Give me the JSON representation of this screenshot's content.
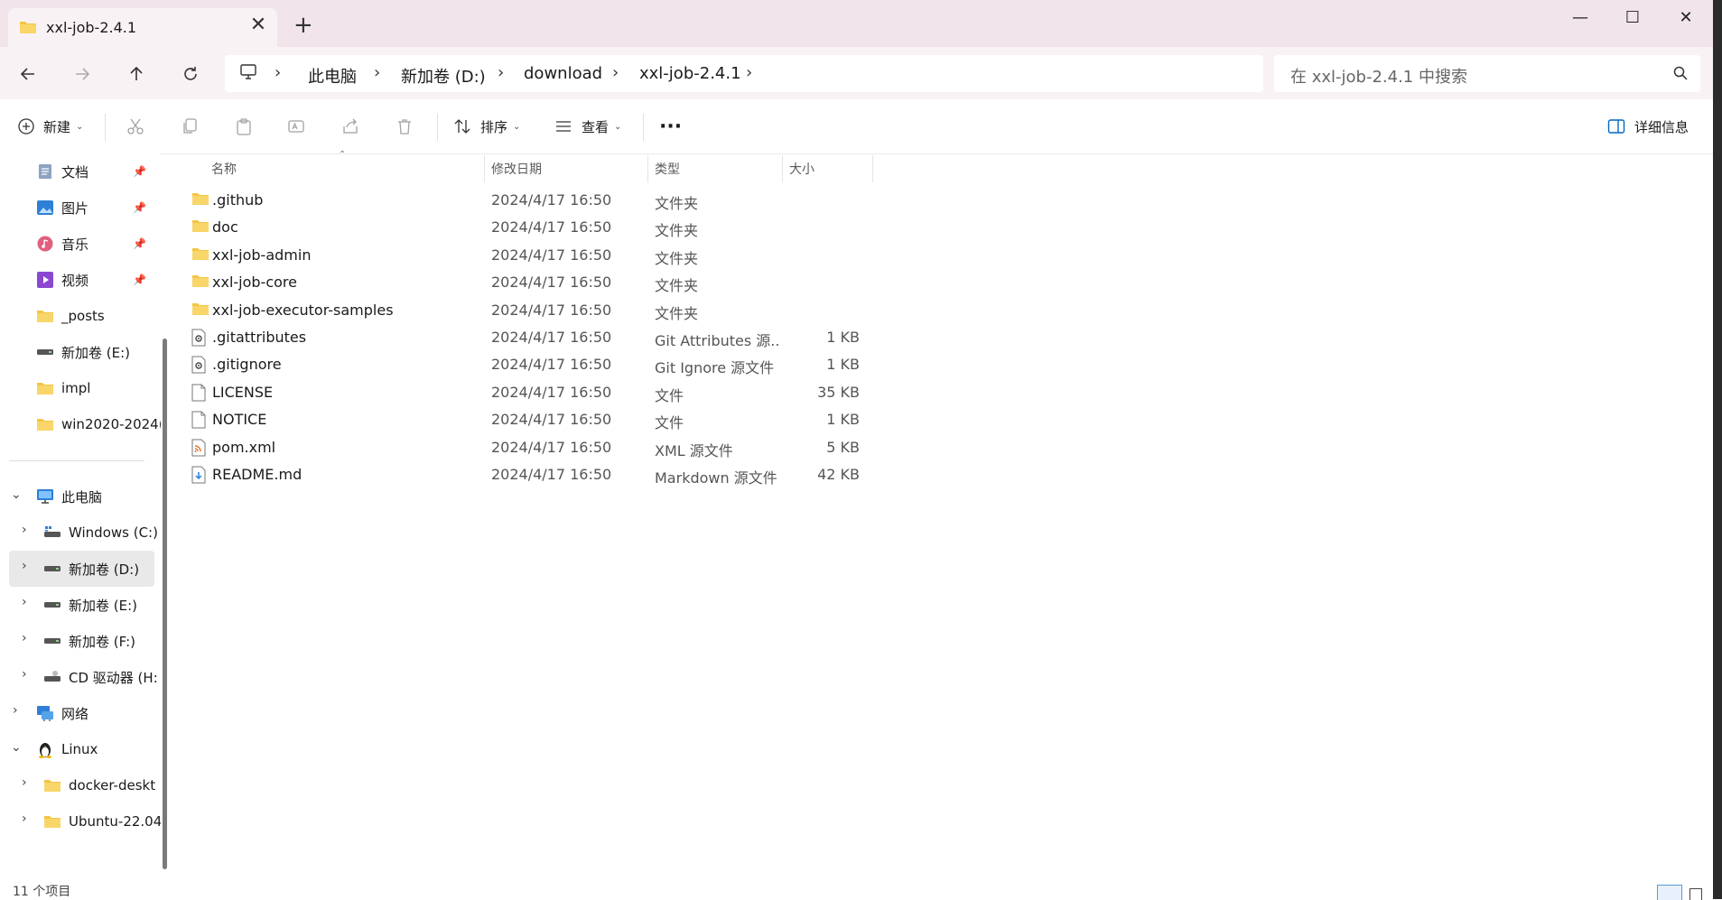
{
  "tab": {
    "title": "xxl-job-2.4.1",
    "close": "✕",
    "new": "+"
  },
  "window": {
    "minimize": "—",
    "maximize": "☐",
    "close": "✕"
  },
  "breadcrumb": [
    "此电脑",
    "新加卷 (D:)",
    "download",
    "xxl-job-2.4.1"
  ],
  "search": {
    "placeholder": "在 xxl-job-2.4.1 中搜索"
  },
  "toolbar": {
    "new_label": "新建",
    "sort_label": "排序",
    "view_label": "查看",
    "more_label": "···",
    "details_label": "详细信息"
  },
  "sidebar": {
    "quick": [
      {
        "label": "文档",
        "icon": "documents-icon",
        "pinned": true
      },
      {
        "label": "图片",
        "icon": "pictures-icon",
        "pinned": true
      },
      {
        "label": "音乐",
        "icon": "music-icon",
        "pinned": true
      },
      {
        "label": "视频",
        "icon": "videos-icon",
        "pinned": true
      },
      {
        "label": "_posts",
        "icon": "folder-icon",
        "pinned": false
      },
      {
        "label": "新加卷 (E:)",
        "icon": "drive-icon",
        "pinned": false
      },
      {
        "label": "impl",
        "icon": "folder-icon",
        "pinned": false
      },
      {
        "label": "win2020-2024(",
        "icon": "folder-icon",
        "pinned": false
      }
    ],
    "tree": [
      {
        "label": "此电脑",
        "icon": "pc-icon",
        "level": 0,
        "expanded": true
      },
      {
        "label": "Windows (C:)",
        "icon": "windows-drive-icon",
        "level": 1
      },
      {
        "label": "新加卷 (D:)",
        "icon": "drive-icon",
        "level": 1,
        "selected": true
      },
      {
        "label": "新加卷 (E:)",
        "icon": "drive-icon",
        "level": 1
      },
      {
        "label": "新加卷 (F:)",
        "icon": "drive-icon",
        "level": 1
      },
      {
        "label": "CD 驱动器 (H:",
        "icon": "cd-drive-icon",
        "level": 1
      },
      {
        "label": "网络",
        "icon": "network-icon",
        "level": 0
      },
      {
        "label": "Linux",
        "icon": "linux-icon",
        "level": 0,
        "expanded": true
      },
      {
        "label": "docker-deskt",
        "icon": "folder-icon",
        "level": 1
      },
      {
        "label": "Ubuntu-22.04",
        "icon": "folder-icon",
        "level": 1
      }
    ]
  },
  "columns": {
    "name": "名称",
    "date": "修改日期",
    "type": "类型",
    "size": "大小"
  },
  "files": [
    {
      "name": ".github",
      "date": "2024/4/17 16:50",
      "type": "文件夹",
      "size": "",
      "icon": "folder-icon"
    },
    {
      "name": "doc",
      "date": "2024/4/17 16:50",
      "type": "文件夹",
      "size": "",
      "icon": "folder-icon"
    },
    {
      "name": "xxl-job-admin",
      "date": "2024/4/17 16:50",
      "type": "文件夹",
      "size": "",
      "icon": "folder-icon"
    },
    {
      "name": "xxl-job-core",
      "date": "2024/4/17 16:50",
      "type": "文件夹",
      "size": "",
      "icon": "folder-icon"
    },
    {
      "name": "xxl-job-executor-samples",
      "date": "2024/4/17 16:50",
      "type": "文件夹",
      "size": "",
      "icon": "folder-icon"
    },
    {
      "name": ".gitattributes",
      "date": "2024/4/17 16:50",
      "type": "Git Attributes 源...",
      "size": "1 KB",
      "icon": "config-file-icon"
    },
    {
      "name": ".gitignore",
      "date": "2024/4/17 16:50",
      "type": "Git Ignore 源文件",
      "size": "1 KB",
      "icon": "config-file-icon"
    },
    {
      "name": "LICENSE",
      "date": "2024/4/17 16:50",
      "type": "文件",
      "size": "35 KB",
      "icon": "blank-file-icon"
    },
    {
      "name": "NOTICE",
      "date": "2024/4/17 16:50",
      "type": "文件",
      "size": "1 KB",
      "icon": "blank-file-icon"
    },
    {
      "name": "pom.xml",
      "date": "2024/4/17 16:50",
      "type": "XML 源文件",
      "size": "5 KB",
      "icon": "xml-file-icon"
    },
    {
      "name": "README.md",
      "date": "2024/4/17 16:50",
      "type": "Markdown 源文件",
      "size": "42 KB",
      "icon": "markdown-file-icon"
    }
  ],
  "status": {
    "count": "11 个项目"
  },
  "colors": {
    "titlebar": "#f1e4ea",
    "navbar": "#f9f2f5",
    "folder": "#f4c542",
    "accent": "#0067c0"
  }
}
